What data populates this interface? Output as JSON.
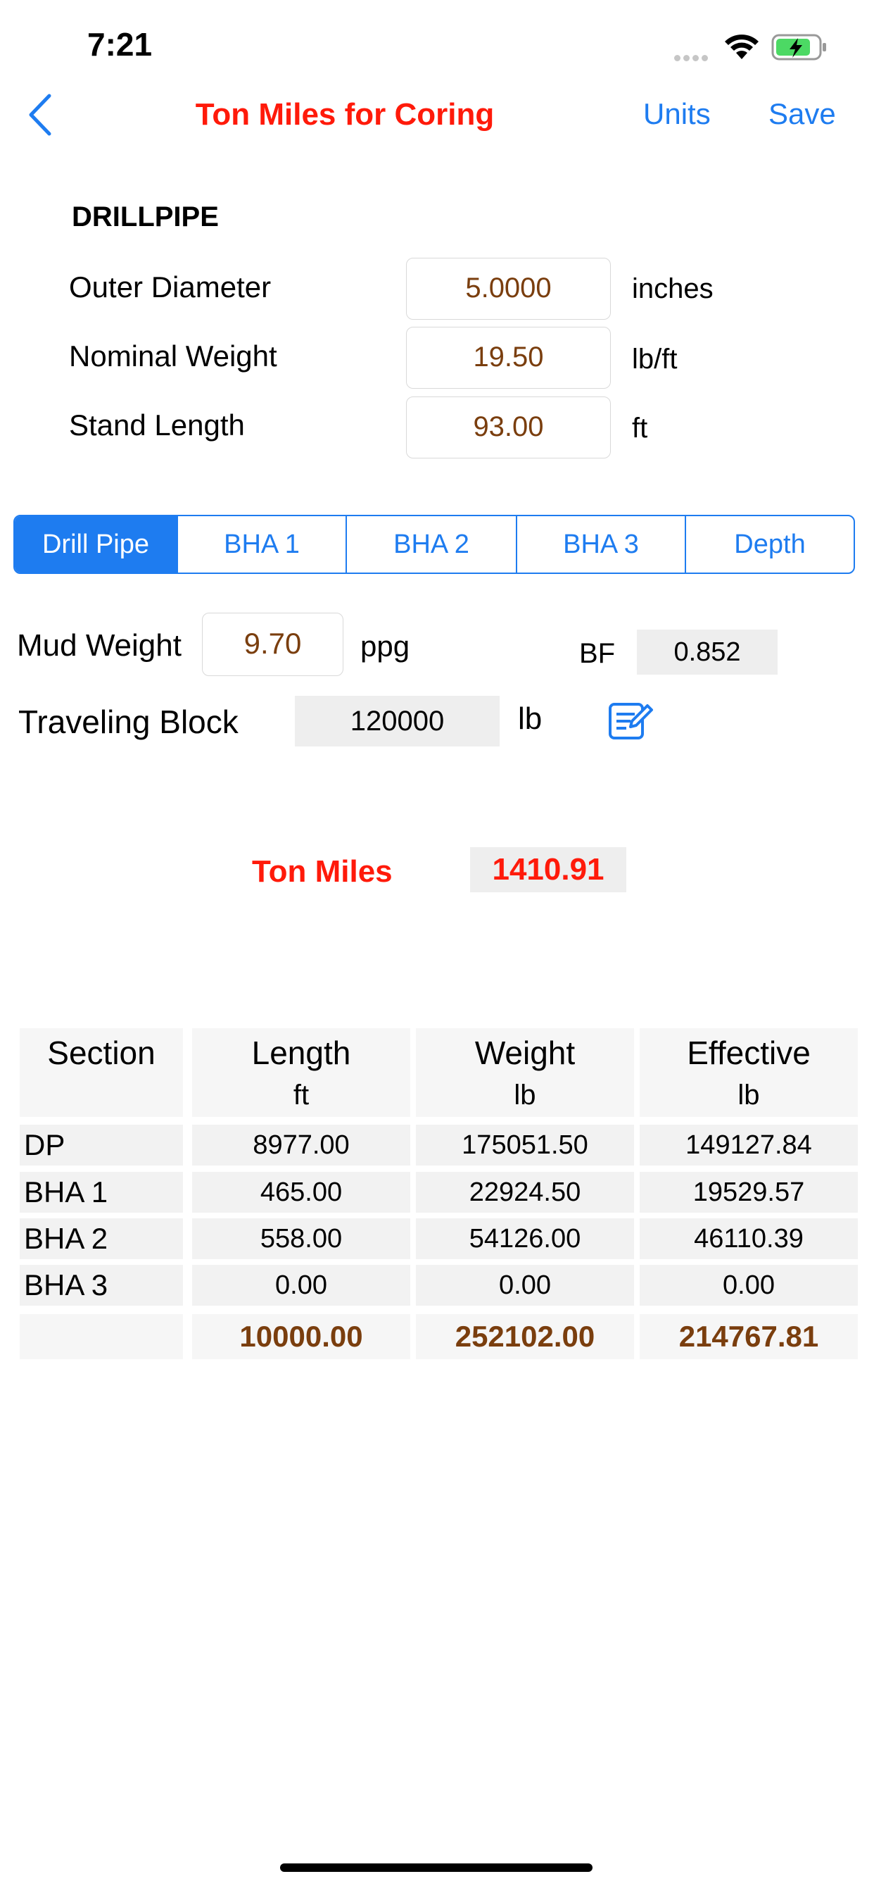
{
  "status_bar": {
    "time": "7:21",
    "signal_icon": "cellular-dots-icon",
    "wifi_icon": "wifi-icon",
    "battery_icon": "battery-charging-icon"
  },
  "nav": {
    "back_icon": "chevron-left-icon",
    "title": "Ton Miles for Coring",
    "units_label": "Units",
    "save_label": "Save"
  },
  "drillpipe": {
    "heading": "DRILLPIPE",
    "rows": [
      {
        "label": "Outer Diameter",
        "value": "5.0000",
        "unit": "inches"
      },
      {
        "label": "Nominal Weight",
        "value": "19.50",
        "unit": "lb/ft"
      },
      {
        "label": "Stand Length",
        "value": "93.00",
        "unit": "ft"
      }
    ]
  },
  "tabs": [
    "Drill Pipe",
    "BHA 1",
    "BHA 2",
    "BHA 3",
    "Depth"
  ],
  "mud": {
    "label": "Mud Weight",
    "value": "9.70",
    "unit": "ppg",
    "bf_label": "BF",
    "bf_value": "0.852"
  },
  "block": {
    "label": "Traveling Block",
    "value": "120000",
    "unit": "lb",
    "edit_icon": "edit-note-icon"
  },
  "result": {
    "label": "Ton Miles",
    "value": "1410.91"
  },
  "table": {
    "headers": [
      {
        "title": "Section",
        "unit": ""
      },
      {
        "title": "Length",
        "unit": "ft"
      },
      {
        "title": "Weight",
        "unit": "lb"
      },
      {
        "title": "Effective",
        "unit": "lb"
      }
    ],
    "rows": [
      [
        "DP",
        "8977.00",
        "175051.50",
        "149127.84"
      ],
      [
        "BHA 1",
        "465.00",
        "22924.50",
        "19529.57"
      ],
      [
        "BHA 2",
        "558.00",
        "54126.00",
        "46110.39"
      ],
      [
        "BHA 3",
        "0.00",
        "0.00",
        "0.00"
      ]
    ],
    "totals": [
      "",
      "10000.00",
      "252102.00",
      "214767.81"
    ]
  },
  "colors": {
    "accent": "#1e7cf0",
    "title_red": "#ff1a0a",
    "value_brown": "#7a3e0e"
  }
}
